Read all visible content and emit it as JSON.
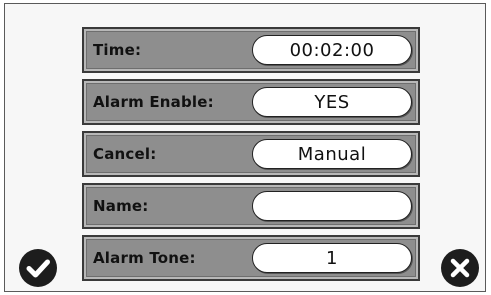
{
  "form": {
    "rows": [
      {
        "label": "Time:",
        "value": "00:02:00"
      },
      {
        "label": "Alarm Enable:",
        "value": "YES"
      },
      {
        "label": "Cancel:",
        "value": "Manual"
      },
      {
        "label": "Name:",
        "value": ""
      },
      {
        "label": "Alarm Tone:",
        "value": "1"
      }
    ]
  },
  "actions": {
    "confirm_icon": "checkmark-icon",
    "cancel_icon": "close-icon"
  },
  "colors": {
    "row_background": "#8e8e8e",
    "field_background": "#ffffff",
    "icon_fill": "#1d1d1d"
  }
}
